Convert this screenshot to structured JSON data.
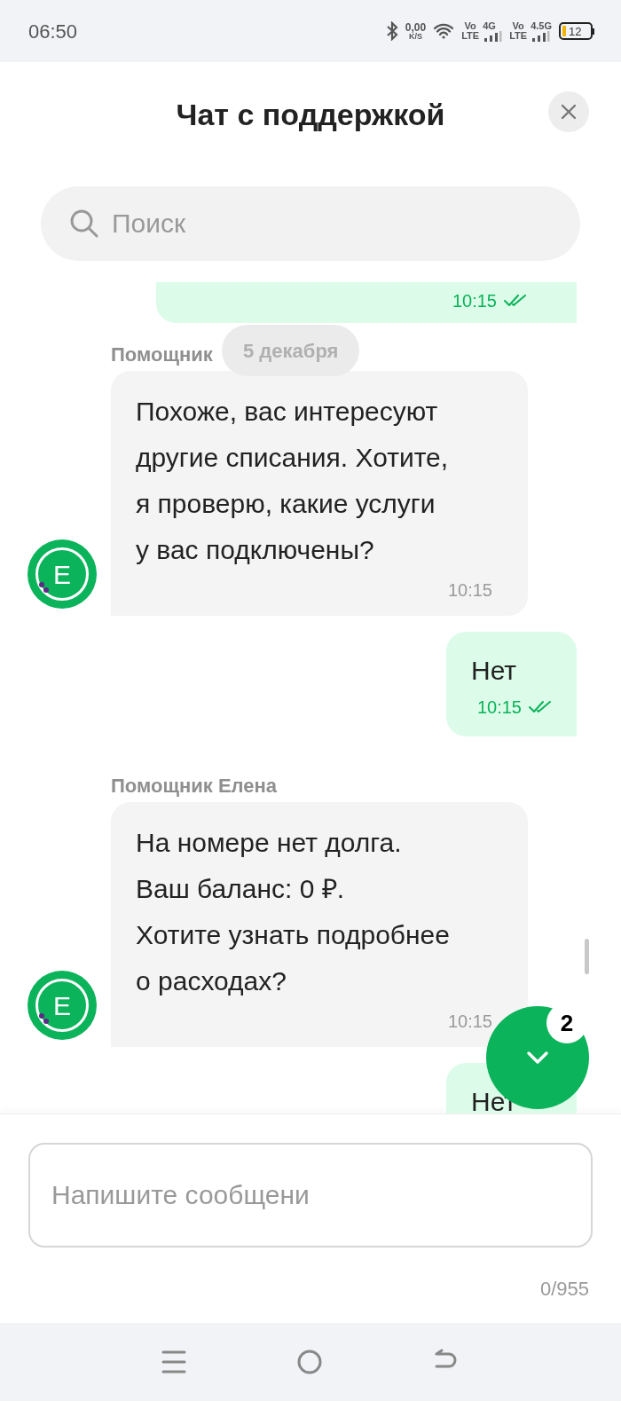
{
  "status_bar": {
    "time": "06:50",
    "speed_value": "0,00",
    "speed_unit": "K/S",
    "sims": [
      {
        "volte_top": "Vo",
        "volte_bottom": "LTE",
        "network": "4G"
      },
      {
        "volte_top": "Vo",
        "volte_bottom": "LTE",
        "network": "4.5G"
      }
    ],
    "battery": "12"
  },
  "header": {
    "title": "Чат с поддержкой"
  },
  "search": {
    "placeholder": "Поиск"
  },
  "messages": [
    {
      "kind": "outgoing",
      "time": "10:15",
      "read": true
    },
    {
      "kind": "date",
      "label": "5 декабря"
    },
    {
      "kind": "incoming",
      "sender": "Помощник",
      "text": "Похоже, вас интересуют\nдругие списания. Хотите,\nя проверю, какие услуги\nу вас подключены?",
      "time": "10:15",
      "avatar": "Е"
    },
    {
      "kind": "outgoing",
      "text": "Нет",
      "time": "10:15",
      "read": true
    },
    {
      "kind": "incoming",
      "sender": "Помощник Елена",
      "text": "На номере нет долга.\nВаш баланс: 0 ₽.\nХотите узнать подробнее\nо расходах?",
      "time": "10:15",
      "avatar": "Е"
    },
    {
      "kind": "outgoing",
      "text": "Нет"
    }
  ],
  "scroll_button": {
    "badge": "2"
  },
  "composer": {
    "placeholder": "Напишите сообщени",
    "counter": "0/955"
  }
}
